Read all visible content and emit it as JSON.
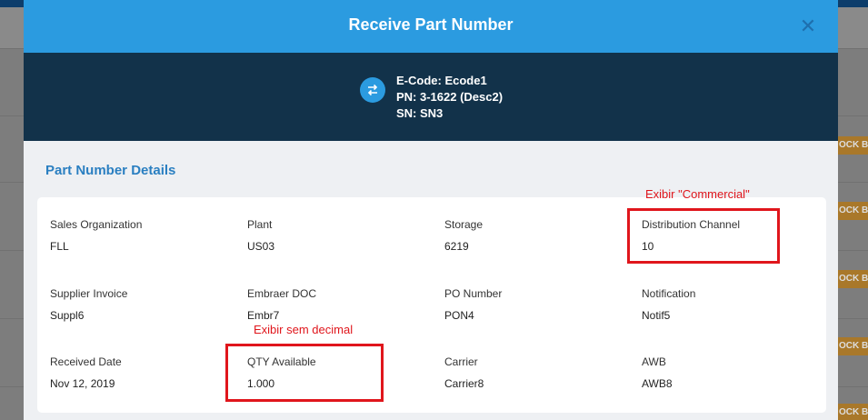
{
  "background": {
    "badge_text": "OCK B"
  },
  "modal": {
    "title": "Receive Part Number",
    "close_symbol": "✕",
    "info": {
      "ecode": "E-Code: Ecode1",
      "pn": "PN: 3-1622 (Desc2)",
      "sn": "SN: SN3"
    },
    "section_title": "Part Number Details",
    "fields": {
      "sales_org": {
        "label": "Sales Organization",
        "value": "FLL"
      },
      "plant": {
        "label": "Plant",
        "value": "US03"
      },
      "storage": {
        "label": "Storage",
        "value": "6219"
      },
      "distribution_channel": {
        "label": "Distribution Channel",
        "value": "10"
      },
      "supplier_invoice": {
        "label": "Supplier Invoice",
        "value": "Suppl6"
      },
      "embraer_doc": {
        "label": "Embraer DOC",
        "value": "Embr7"
      },
      "po_number": {
        "label": "PO Number",
        "value": "PON4"
      },
      "notification": {
        "label": "Notification",
        "value": "Notif5"
      },
      "received_date": {
        "label": "Received Date",
        "value": "Nov 12, 2019"
      },
      "qty_available": {
        "label": "QTY Available",
        "value": "1.000"
      },
      "carrier": {
        "label": "Carrier",
        "value": "Carrier8"
      },
      "awb": {
        "label": "AWB",
        "value": "AWB8"
      }
    }
  },
  "annotations": {
    "commercial": "Exibir \"Commercial\"",
    "no_decimal": "Exibir sem decimal"
  },
  "colors": {
    "header_blue": "#2b9be0",
    "info_band": "#12324a",
    "section_title": "#2a7fc1",
    "annotation_red": "#e0161c"
  }
}
